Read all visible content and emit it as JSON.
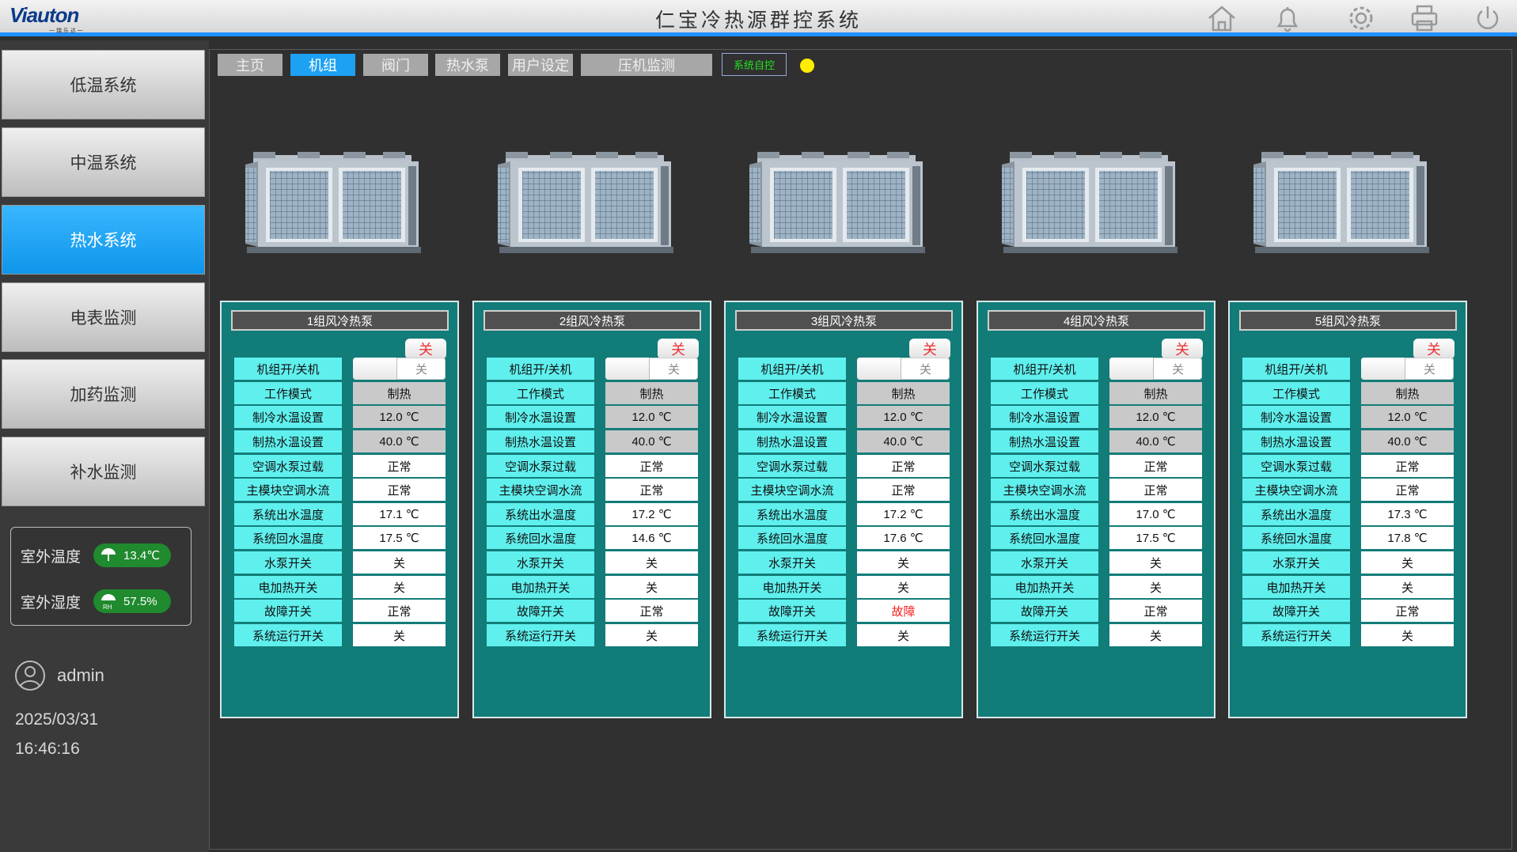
{
  "header": {
    "logo_text": "Viauton",
    "logo_sub": "一 瑞 乐 达 一",
    "title": "仁宝冷热源群控系统",
    "icons": [
      "home-icon",
      "bell-icon",
      "gear-icon",
      "printer-icon",
      "power-icon"
    ]
  },
  "sidebar": {
    "items": [
      {
        "label": "低温系统",
        "active": false
      },
      {
        "label": "中温系统",
        "active": false
      },
      {
        "label": "热水系统",
        "active": true
      },
      {
        "label": "电表监测",
        "active": false
      },
      {
        "label": "加药监测",
        "active": false
      },
      {
        "label": "补水监测",
        "active": false
      }
    ],
    "weather": {
      "temp_label": "室外温度",
      "temp_value": "13.4℃",
      "humidity_label": "室外湿度",
      "humidity_value": "57.5%"
    },
    "user": "admin",
    "date": "2025/03/31",
    "time": "16:46:16"
  },
  "tabs": [
    {
      "label": "主页",
      "active": false
    },
    {
      "label": "机组",
      "active": true
    },
    {
      "label": "阀门",
      "active": false
    },
    {
      "label": "热水泵",
      "active": false
    },
    {
      "label": "用户设定",
      "active": false
    },
    {
      "label": "压机监测",
      "active": false
    }
  ],
  "auto_button": "系统自控",
  "status_color": "#ffee00",
  "row_labels": [
    "机组开/关机",
    "工作模式",
    "制冷水温设置",
    "制热水温设置",
    "空调水泵过载",
    "主模块空调水流",
    "系统出水温度",
    "系统回水温度",
    "水泵开关",
    "电加热开关",
    "故障开关",
    "系统运行开关"
  ],
  "units": [
    {
      "title": "1组风冷热泵",
      "btn": "关",
      "toggle": "关",
      "mode": "制热",
      "cool_set": "12.0 ℃",
      "heat_set": "40.0 ℃",
      "overload": "正常",
      "flow": "正常",
      "out_temp": "17.1 ℃",
      "ret_temp": "17.5 ℃",
      "pump": "关",
      "heater": "关",
      "fault": "正常",
      "run": "关"
    },
    {
      "title": "2组风冷热泵",
      "btn": "关",
      "toggle": "关",
      "mode": "制热",
      "cool_set": "12.0 ℃",
      "heat_set": "40.0 ℃",
      "overload": "正常",
      "flow": "正常",
      "out_temp": "17.2 ℃",
      "ret_temp": "14.6 ℃",
      "pump": "关",
      "heater": "关",
      "fault": "正常",
      "run": "关"
    },
    {
      "title": "3组风冷热泵",
      "btn": "关",
      "toggle": "关",
      "mode": "制热",
      "cool_set": "12.0 ℃",
      "heat_set": "40.0 ℃",
      "overload": "正常",
      "flow": "正常",
      "out_temp": "17.2 ℃",
      "ret_temp": "17.6 ℃",
      "pump": "关",
      "heater": "关",
      "fault": "故障",
      "run": "关"
    },
    {
      "title": "4组风冷热泵",
      "btn": "关",
      "toggle": "关",
      "mode": "制热",
      "cool_set": "12.0 ℃",
      "heat_set": "40.0 ℃",
      "overload": "正常",
      "flow": "正常",
      "out_temp": "17.0 ℃",
      "ret_temp": "17.5 ℃",
      "pump": "关",
      "heater": "关",
      "fault": "正常",
      "run": "关"
    },
    {
      "title": "5组风冷热泵",
      "btn": "关",
      "toggle": "关",
      "mode": "制热",
      "cool_set": "12.0 ℃",
      "heat_set": "40.0 ℃",
      "overload": "正常",
      "flow": "正常",
      "out_temp": "17.3 ℃",
      "ret_temp": "17.8 ℃",
      "pump": "关",
      "heater": "关",
      "fault": "正常",
      "run": "关"
    }
  ]
}
